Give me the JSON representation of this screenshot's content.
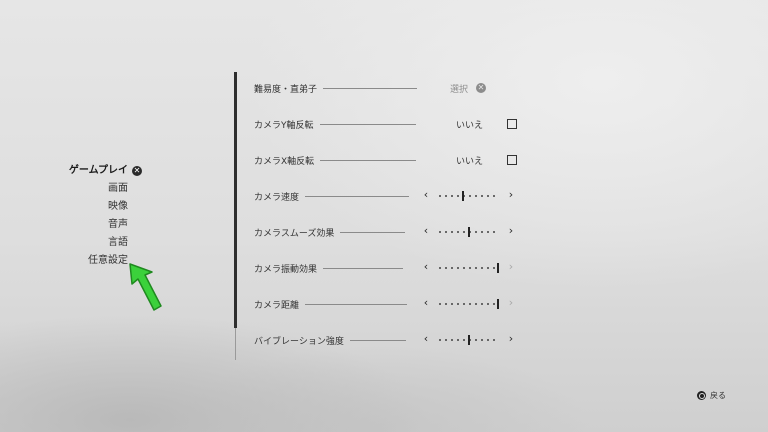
{
  "menu": {
    "items": [
      {
        "label": "ゲームプレイ",
        "active": true
      },
      {
        "label": "画面",
        "active": false
      },
      {
        "label": "映像",
        "active": false
      },
      {
        "label": "音声",
        "active": false
      },
      {
        "label": "言語",
        "active": false
      },
      {
        "label": "任意設定",
        "active": false
      }
    ]
  },
  "settings": {
    "difficulty": {
      "label": "難易度・直弟子",
      "value": "選択"
    },
    "camera_y_invert": {
      "label": "カメラY軸反転",
      "value": "いいえ"
    },
    "camera_x_invert": {
      "label": "カメラX軸反転",
      "value": "いいえ"
    },
    "camera_speed": {
      "label": "カメラ速度",
      "level": 0.4
    },
    "camera_smoothing": {
      "label": "カメラスムーズ効果",
      "level": 0.5
    },
    "camera_shake": {
      "label": "カメラ振動効果",
      "level": 1.0
    },
    "camera_distance": {
      "label": "カメラ距離",
      "level": 1.0
    },
    "vibration": {
      "label": "バイブレーション強度",
      "level": 0.5
    }
  },
  "footer": {
    "back_label": "戻る"
  },
  "colors": {
    "annotation_arrow": "#3bd13b",
    "text": "#2b2b2b",
    "background": "#dedede"
  },
  "icons": {
    "close": "circle-x-icon",
    "back": "circle-button-icon",
    "chevron_left": "‹",
    "chevron_right": "›"
  }
}
